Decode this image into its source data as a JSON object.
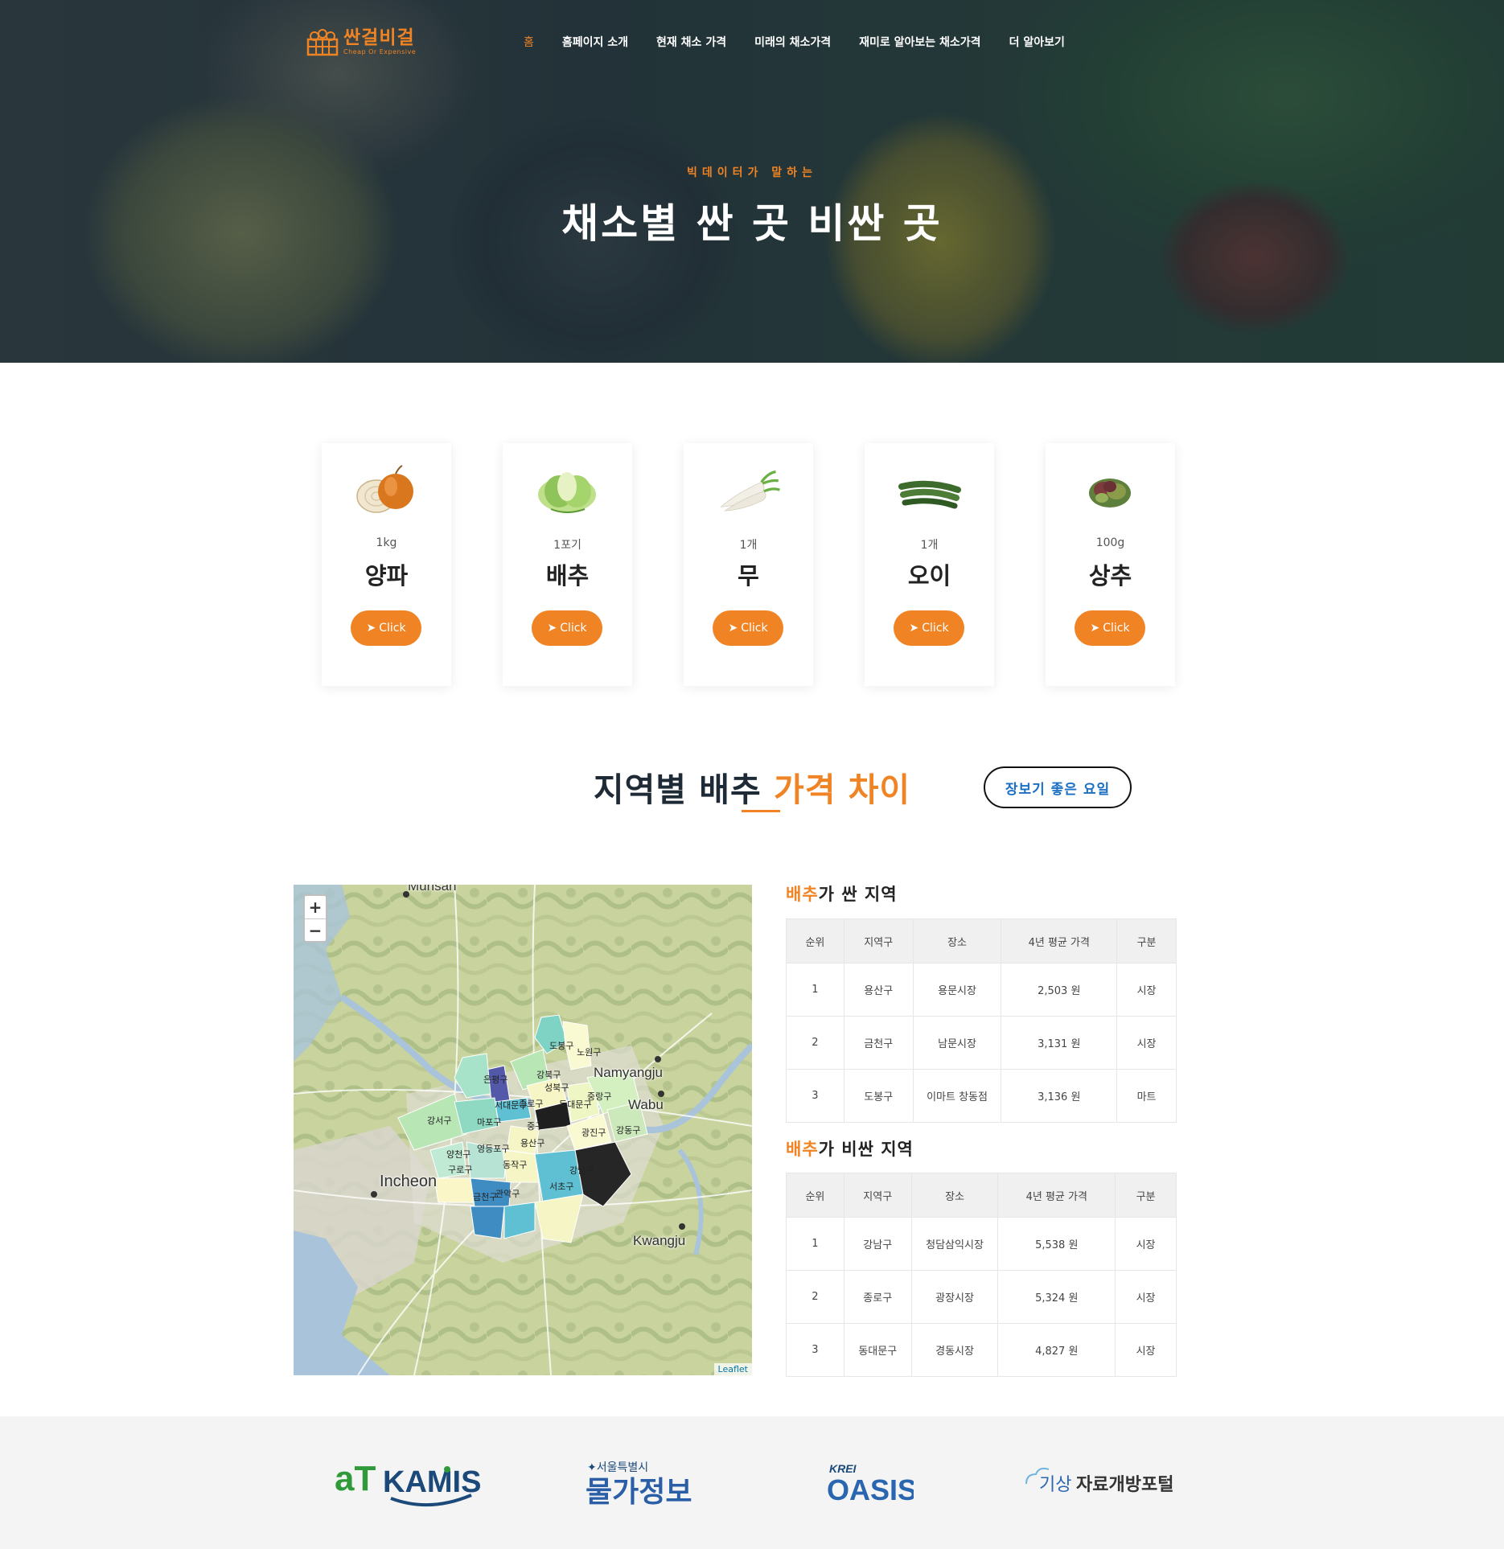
{
  "header": {
    "logo_main": "싼걸비걸",
    "logo_sub": "Cheap Or Expensive",
    "nav": [
      "홈",
      "홈페이지 소개",
      "현재 채소 가격",
      "미래의 채소가격",
      "재미로 알아보는 채소가격",
      "더 알아보기"
    ]
  },
  "hero": {
    "kicker": "빅데이터가 말하는",
    "title": "채소별 싼 곳 비싼 곳"
  },
  "cards": [
    {
      "unit": "1kg",
      "name": "양파",
      "button": "Click",
      "icon": "onion-icon"
    },
    {
      "unit": "1포기",
      "name": "배추",
      "button": "Click",
      "icon": "cabbage-icon"
    },
    {
      "unit": "1개",
      "name": "무",
      "button": "Click",
      "icon": "radish-icon"
    },
    {
      "unit": "1개",
      "name": "오이",
      "button": "Click",
      "icon": "cucumber-icon"
    },
    {
      "unit": "100g",
      "name": "상추",
      "button": "Click",
      "icon": "lettuce-icon"
    }
  ],
  "section": {
    "title_a": "지역별 배추 ",
    "title_b": "가격 차이",
    "day_button": "장보기 좋은 요일"
  },
  "map": {
    "zoom_in": "+",
    "zoom_out": "−",
    "attribution": "Leaflet",
    "places": [
      "Munsan",
      "Namyangju",
      "Wabu",
      "Incheon",
      "Kwangju"
    ],
    "districts": [
      "도봉구",
      "노원구",
      "은평구",
      "강북구",
      "성북구",
      "서대문구",
      "종로구",
      "동대문구",
      "중랑구",
      "강서구",
      "마포구",
      "중구",
      "광진구",
      "강동구",
      "양천구",
      "영등포구",
      "용산구",
      "구로구",
      "동작구",
      "강남구",
      "금천구",
      "관악구",
      "서초구"
    ]
  },
  "cheap_table": {
    "title_a": "배추",
    "title_b": "가 싼 지역",
    "headers": [
      "순위",
      "지역구",
      "장소",
      "4년 평균 가격",
      "구분"
    ],
    "rows": [
      [
        "1",
        "용산구",
        "용문시장",
        "2,503 원",
        "시장"
      ],
      [
        "2",
        "금천구",
        "남문시장",
        "3,131 원",
        "시장"
      ],
      [
        "3",
        "도봉구",
        "이마트 창동점",
        "3,136 원",
        "마트"
      ]
    ]
  },
  "expensive_table": {
    "title_a": "배추",
    "title_b": "가 비싼 지역",
    "headers": [
      "순위",
      "지역구",
      "장소",
      "4년 평균 가격",
      "구분"
    ],
    "rows": [
      [
        "1",
        "강남구",
        "청담삼익시장",
        "5,538 원",
        "시장"
      ],
      [
        "2",
        "종로구",
        "광장시장",
        "5,324 원",
        "시장"
      ],
      [
        "3",
        "동대문구",
        "경동시장",
        "4,827 원",
        "시장"
      ]
    ]
  },
  "footer": {
    "partners": [
      {
        "name": "aTKAMIS",
        "icon": "kamis-logo"
      },
      {
        "name": "서울특별시 물가정보",
        "icon": "seoul-price-logo"
      },
      {
        "name": "KREI OASIS",
        "icon": "krei-oasis-logo"
      },
      {
        "name": "기상자료개방포털",
        "icon": "weather-data-portal-logo"
      }
    ]
  },
  "colors": {
    "accent": "#f08424",
    "link_blue": "#1a6fc4",
    "dark": "#1e2a35"
  }
}
